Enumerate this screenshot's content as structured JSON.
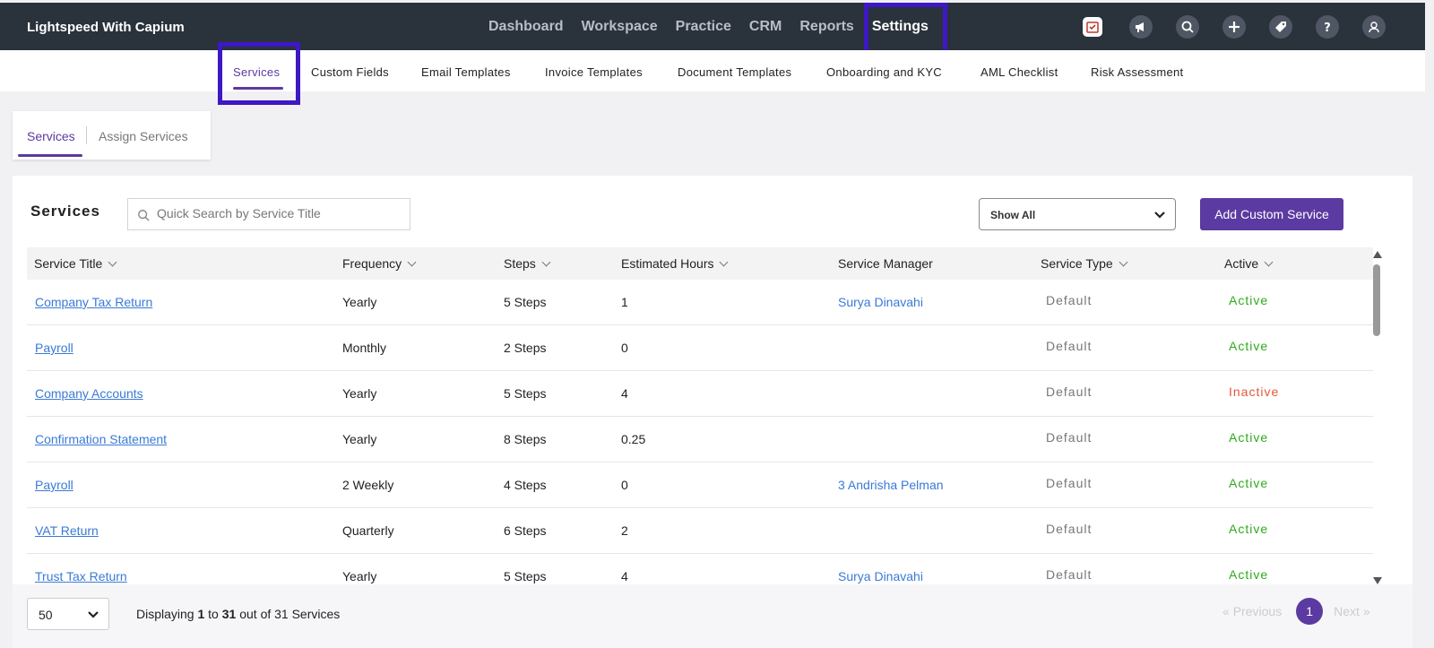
{
  "app": {
    "brand": "Lightspeed With Capium"
  },
  "topnav": {
    "items": [
      {
        "label": "Dashboard",
        "active": false
      },
      {
        "label": "Workspace",
        "active": false
      },
      {
        "label": "Practice",
        "active": false
      },
      {
        "label": "CRM",
        "active": false
      },
      {
        "label": "Reports",
        "active": false
      },
      {
        "label": "Settings",
        "active": true
      }
    ],
    "icons": [
      "calendar-icon",
      "megaphone-icon",
      "search-icon",
      "plus-icon",
      "tag-icon",
      "help-icon",
      "user-icon"
    ]
  },
  "subnav": {
    "items": [
      {
        "label": "Services",
        "active": true
      },
      {
        "label": "Custom Fields"
      },
      {
        "label": "Email Templates"
      },
      {
        "label": "Invoice Templates"
      },
      {
        "label": "Document Templates"
      },
      {
        "label": "Onboarding and KYC"
      },
      {
        "label": "AML Checklist"
      },
      {
        "label": "Risk Assessment"
      }
    ]
  },
  "tabs": {
    "services": "Services",
    "assign": "Assign Services"
  },
  "main": {
    "title": "Services",
    "search_placeholder": "Quick Search by Service Title",
    "filter_value": "Show All",
    "add_button": "Add Custom Service"
  },
  "table": {
    "columns": [
      "Service Title",
      "Frequency",
      "Steps",
      "Estimated Hours",
      "Service Manager",
      "Service Type",
      "Active"
    ],
    "rows": [
      {
        "title": "Company Tax Return",
        "frequency": "Yearly",
        "steps": "5 Steps",
        "hours": "1",
        "manager": "Surya Dinavahi",
        "type": "Default",
        "status": "Active"
      },
      {
        "title": "Payroll",
        "frequency": "Monthly",
        "steps": "2 Steps",
        "hours": "0",
        "manager": "",
        "type": "Default",
        "status": "Active"
      },
      {
        "title": "Company Accounts",
        "frequency": "Yearly",
        "steps": "5 Steps",
        "hours": "4",
        "manager": "",
        "type": "Default",
        "status": "Inactive"
      },
      {
        "title": "Confirmation Statement",
        "frequency": "Yearly",
        "steps": "8 Steps",
        "hours": "0.25",
        "manager": "",
        "type": "Default",
        "status": "Active"
      },
      {
        "title": "Payroll",
        "frequency": "2 Weekly",
        "steps": "4 Steps",
        "hours": "0",
        "manager": "3 Andrisha Pelman",
        "type": "Default",
        "status": "Active"
      },
      {
        "title": "VAT Return",
        "frequency": "Quarterly",
        "steps": "6 Steps",
        "hours": "2",
        "manager": "",
        "type": "Default",
        "status": "Active"
      },
      {
        "title": "Trust Tax Return",
        "frequency": "Yearly",
        "steps": "5 Steps",
        "hours": "4",
        "manager": "Surya Dinavahi",
        "type": "Default",
        "status": "Active"
      }
    ]
  },
  "footer": {
    "page_size": "50",
    "displaying_prefix": "Displaying",
    "from": "1",
    "to_word": "to",
    "to": "31",
    "out_of_text": "out of 31 Services",
    "prev": "Previous",
    "next": "Next",
    "current_page": "1"
  },
  "colors": {
    "accent": "#5b3aa1",
    "highlight_box": "#3d18c4",
    "active": "#2eaa1c",
    "inactive": "#e4573a",
    "link": "#3a7ad6",
    "nav_bg": "#2a323c"
  }
}
